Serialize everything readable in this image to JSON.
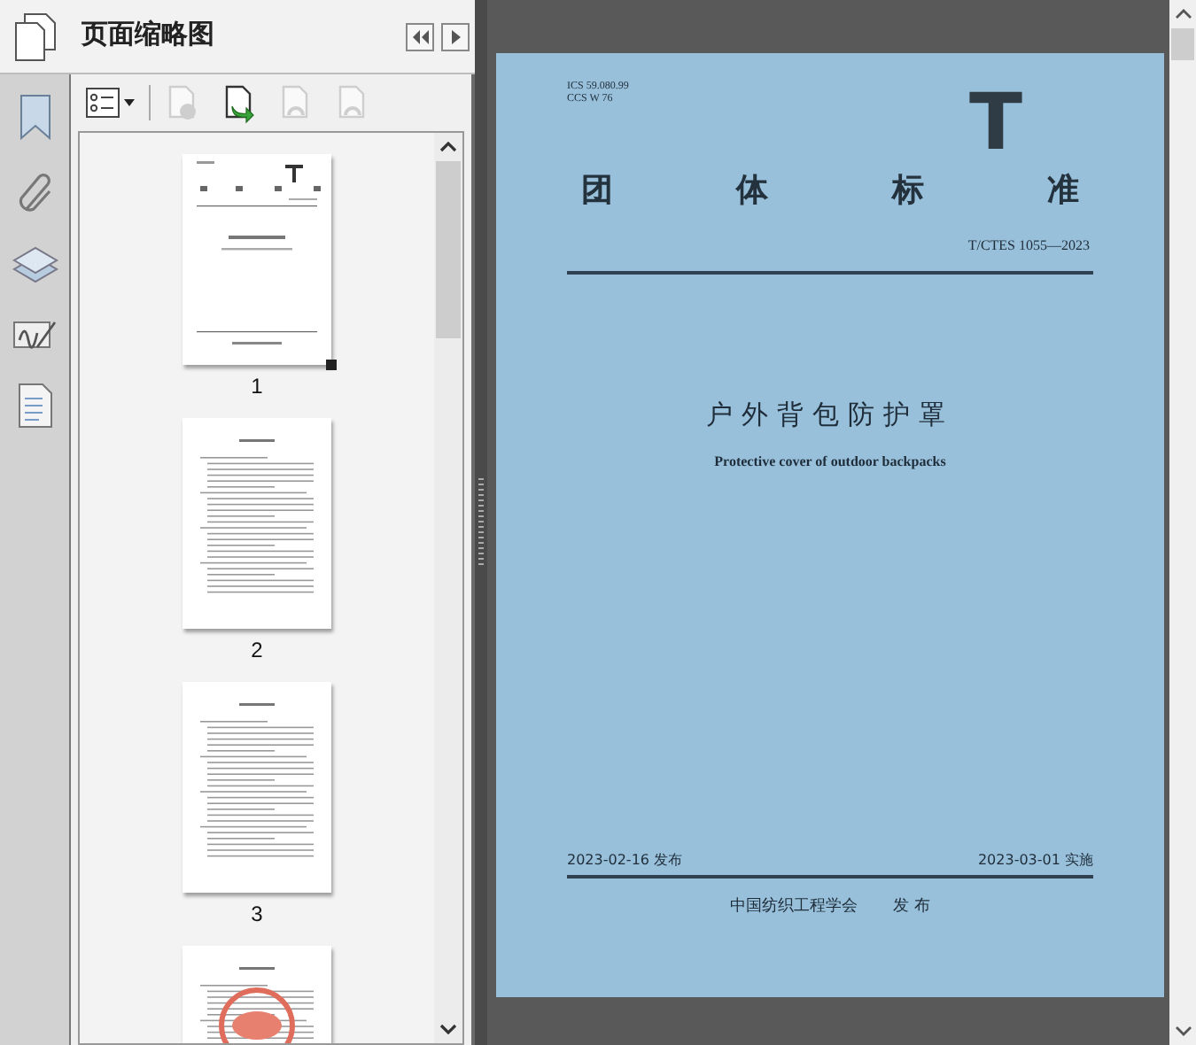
{
  "panel": {
    "title": "页面缩略图"
  },
  "toolbar": [
    {
      "kind": "options",
      "disabled": false
    },
    {
      "kind": "delete",
      "disabled": true
    },
    {
      "kind": "rotate",
      "disabled": false
    },
    {
      "kind": "ccw",
      "disabled": true
    },
    {
      "kind": "cw",
      "disabled": true
    }
  ],
  "thumbnails": [
    {
      "label": "1",
      "kind": "cover"
    },
    {
      "label": "2",
      "kind": "text"
    },
    {
      "label": "3",
      "kind": "text"
    },
    {
      "kind": "stamp"
    }
  ],
  "document": {
    "ics": "ICS 59.080.99",
    "ccs": "CCS W 76",
    "logo": "T",
    "heading": [
      "团",
      "体",
      "标",
      "准"
    ],
    "code": "T/CTES 1055—2023",
    "title": "户外背包防护罩",
    "subtitle": "Protective cover of outdoor backpacks",
    "publish_date": "2023-02-16 发布",
    "implement_date": "2023-03-01 实施",
    "publisher": "中国纺织工程学会",
    "publisher_action": "发 布"
  }
}
